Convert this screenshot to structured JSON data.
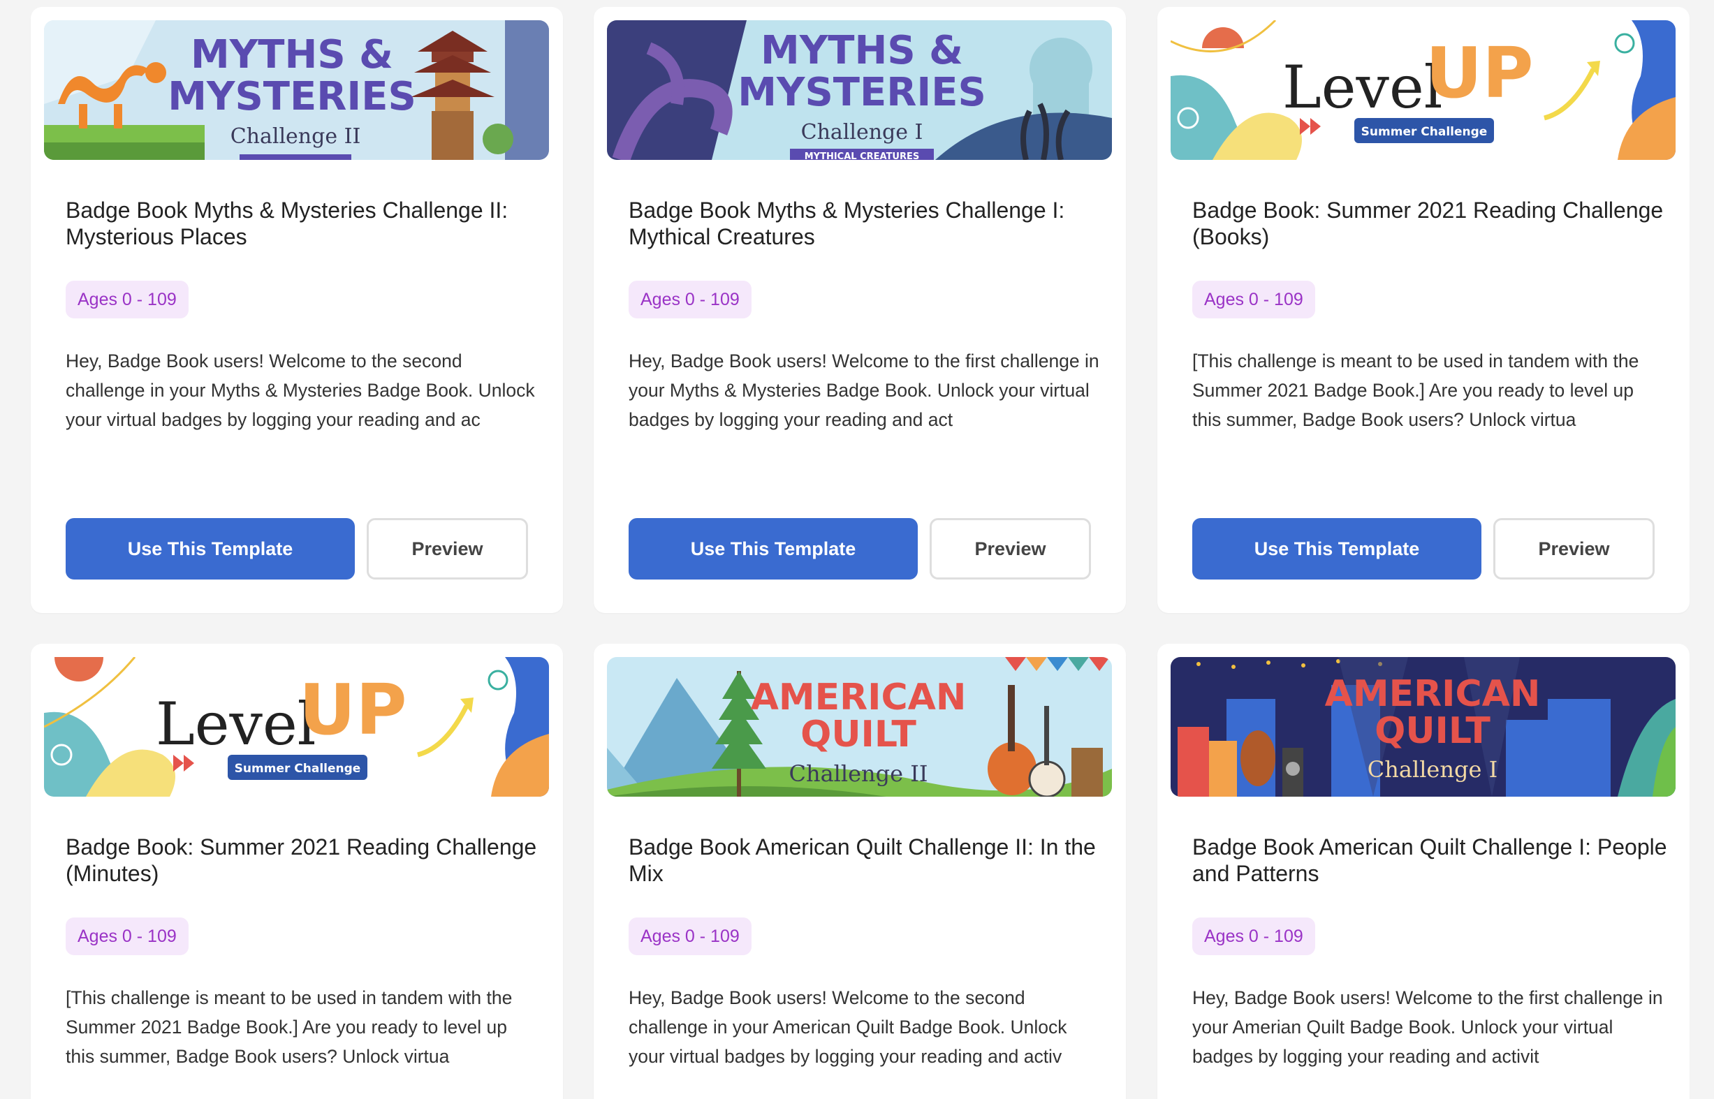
{
  "cards": [
    {
      "banner": {
        "title_line1": "MYTHS &",
        "title_line2": "MYSTERIES",
        "subtitle": "Challenge II"
      },
      "title": "Badge Book Myths & Mysteries Challenge II: Mysterious Places",
      "ages": "Ages 0 - 109",
      "description": "Hey, Badge Book users! Welcome to the second challenge in your Myths & Mysteries Badge Book. Unlock your virtual badges by logging your reading and ac",
      "primary_label": "Use This Template",
      "secondary_label": "Preview"
    },
    {
      "banner": {
        "title_line1": "MYTHS &",
        "title_line2": "MYSTERIES",
        "subtitle": "Challenge I",
        "ribbon": "MYTHICAL CREATURES"
      },
      "title": "Badge Book Myths & Mysteries Challenge I: Mythical Creatures",
      "ages": "Ages 0 - 109",
      "description": "Hey, Badge Book users! Welcome to the first challenge in your Myths & Mysteries Badge Book. Unlock your virtual badges by logging your reading and act",
      "primary_label": "Use This Template",
      "secondary_label": "Preview"
    },
    {
      "banner": {
        "word1": "Level",
        "word2": "UP",
        "tag": "Summer Challenge"
      },
      "title": "Badge Book: Summer 2021 Reading Challenge (Books)",
      "ages": "Ages 0 - 109",
      "description": "[This challenge is meant to be used in tandem with the Summer 2021 Badge Book.] Are you ready to level up this summer, Badge Book users? Unlock virtua",
      "primary_label": "Use This Template",
      "secondary_label": "Preview"
    },
    {
      "banner": {
        "word1": "Level",
        "word2": "UP",
        "tag": "Summer Challenge"
      },
      "title": "Badge Book: Summer 2021 Reading Challenge (Minutes)",
      "ages": "Ages 0 - 109",
      "description": "[This challenge is meant to be used in tandem with the Summer 2021 Badge Book.] Are you ready to level up this summer, Badge Book users? Unlock virtua"
    },
    {
      "banner": {
        "title_line1": "AMERICAN",
        "title_line2": "QUILT",
        "subtitle": "Challenge II"
      },
      "title": "Badge Book American Quilt Challenge II: In the Mix",
      "ages": "Ages 0 - 109",
      "description": "Hey, Badge Book users! Welcome to the second challenge in your American Quilt Badge Book. Unlock your virtual badges by logging your reading and activ"
    },
    {
      "banner": {
        "title_line1": "AMERICAN",
        "title_line2": "QUILT",
        "subtitle": "Challenge I"
      },
      "title": "Badge Book American Quilt Challenge I: People and Patterns",
      "ages": "Ages 0 - 109",
      "description": "Hey, Badge Book users! Welcome to the first challenge in your Amerian Quilt Badge Book. Unlock your virtual badges by logging your reading and activit"
    }
  ]
}
